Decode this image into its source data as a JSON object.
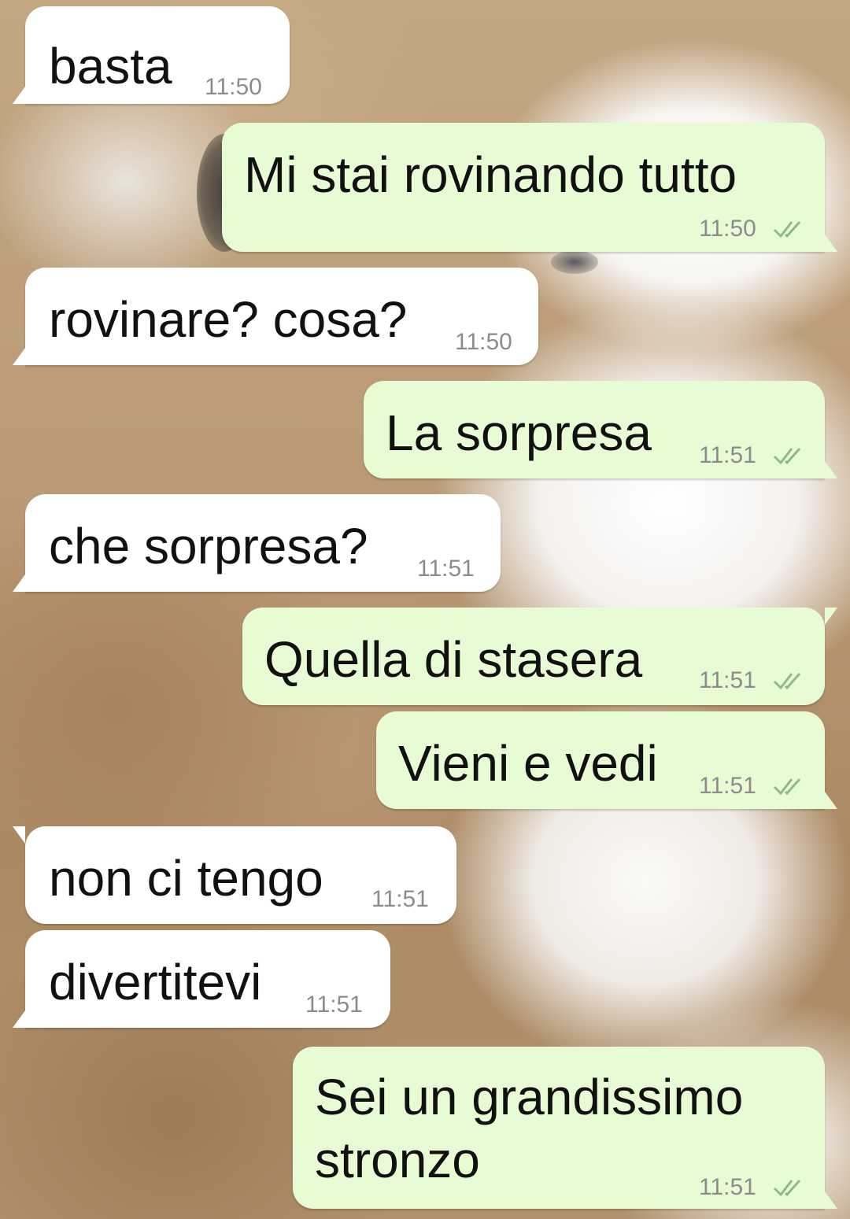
{
  "chat": {
    "messages": [
      {
        "direction": "in",
        "text": "basta",
        "time": "11:50"
      },
      {
        "direction": "out",
        "text": "Mi stai rovinando tutto",
        "time": "11:50",
        "status_icon": "double-check-icon"
      },
      {
        "direction": "in",
        "text": "rovinare? cosa?",
        "time": "11:50"
      },
      {
        "direction": "out",
        "text": "La sorpresa",
        "time": "11:51",
        "status_icon": "double-check-icon"
      },
      {
        "direction": "in",
        "text": "che sorpresa?",
        "time": "11:51"
      },
      {
        "direction": "out",
        "text": "Quella di stasera",
        "time": "11:51",
        "status_icon": "double-check-icon"
      },
      {
        "direction": "out",
        "text": "Vieni e vedi",
        "time": "11:51",
        "status_icon": "double-check-icon"
      },
      {
        "direction": "in",
        "text": "non ci tengo",
        "time": "11:51"
      },
      {
        "direction": "in",
        "text": "divertitevi",
        "time": "11:51"
      },
      {
        "direction": "out",
        "text_lines": [
          "Sei un grandissimo",
          "stronzo"
        ],
        "time": "11:51",
        "status_icon": "double-check-icon"
      }
    ]
  },
  "colors": {
    "incoming_bubble": "#ffffff",
    "outgoing_bubble": "#e7fbd5",
    "read_ticks": "#8fb98a",
    "timestamp": "#8c8c8c"
  }
}
